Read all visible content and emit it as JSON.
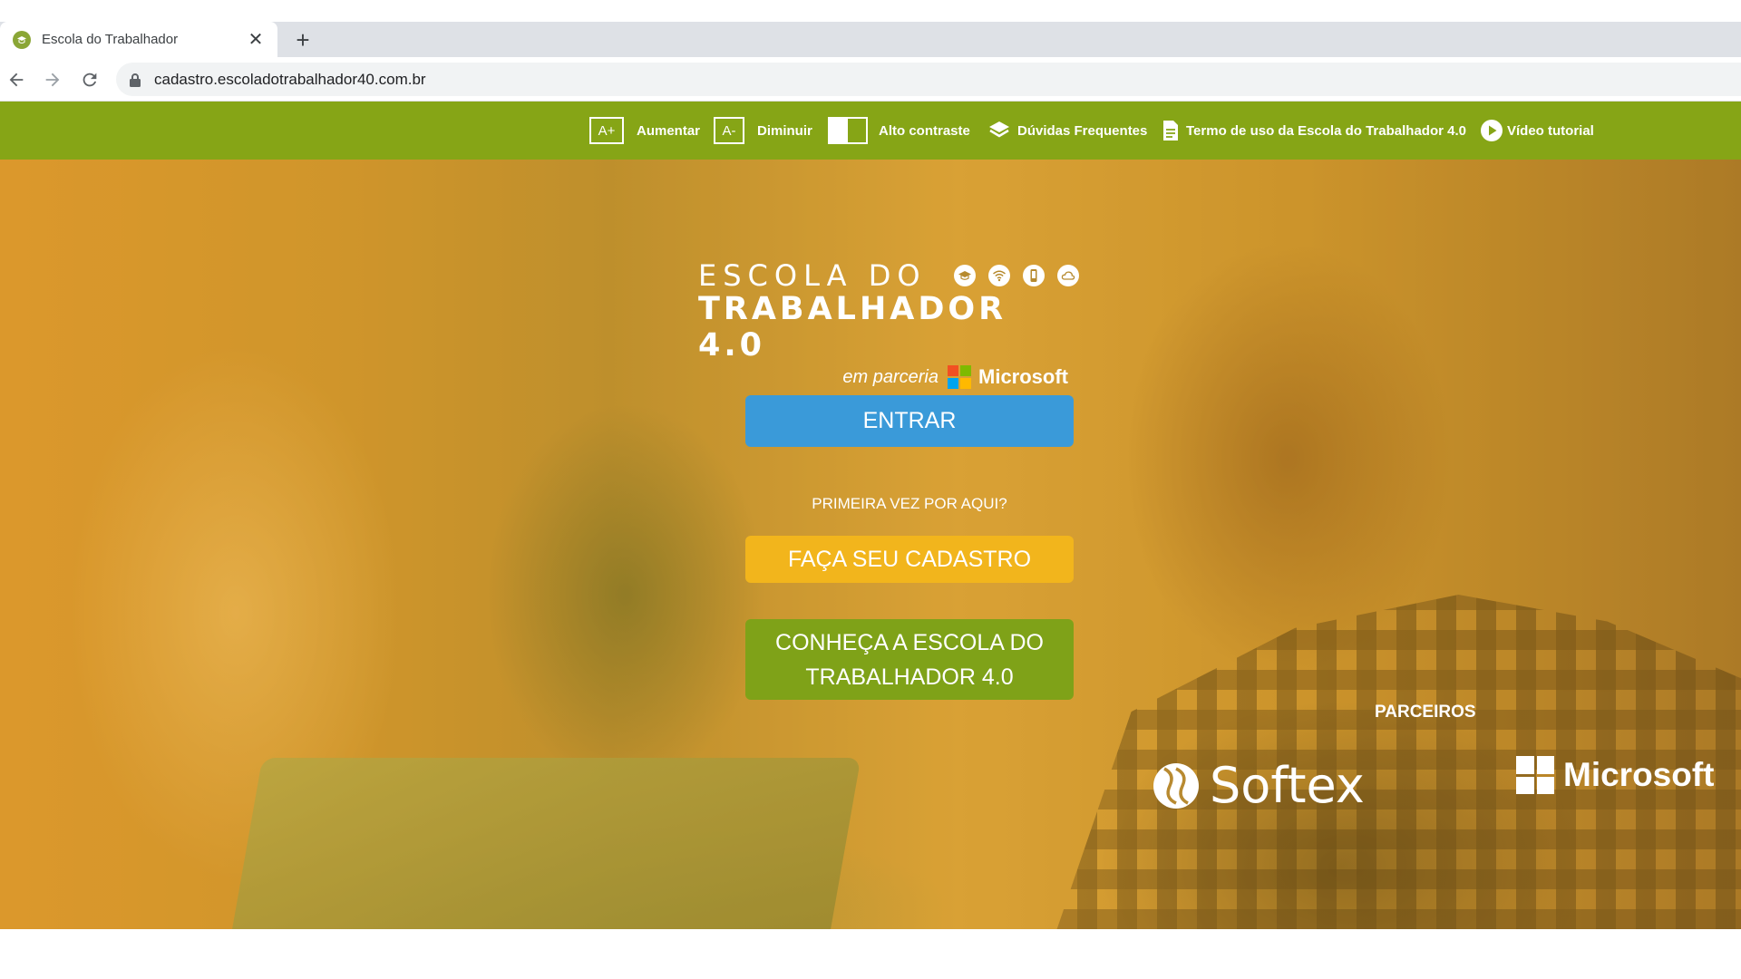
{
  "browser": {
    "tab_title": "Escola do Trabalhador",
    "tab_close": "✕",
    "new_tab": "+",
    "url": "cadastro.escoladotrabalhador40.com.br"
  },
  "accessibility_bar": {
    "increase_box": "A+",
    "increase_label": "Aumentar",
    "decrease_box": "A-",
    "decrease_label": "Diminuir",
    "contrast_label": "Alto contraste",
    "faq_label": "Dúvidas Frequentes",
    "terms_label": "Termo de uso da Escola do Trabalhador 4.0",
    "tutorial_label": "Vídeo tutorial",
    "bar_color": "#86a516"
  },
  "logo": {
    "line1": "ESCOLA DO",
    "line2": "TRABALHADOR 4.0",
    "partner_text": "em parceria",
    "partner_name": "Microsoft",
    "icons": [
      "graduation-cap-icon",
      "wifi-icon",
      "phone-icon",
      "cloud-icon"
    ]
  },
  "actions": {
    "login_label": "ENTRAR",
    "first_time_text": "PRIMEIRA VEZ POR AQUI?",
    "signup_label": "FAÇA SEU CADASTRO",
    "about_line1": "CONHEÇA A ESCOLA DO",
    "about_line2": "TRABALHADOR 4.0",
    "colors": {
      "login": "#3a9ad9",
      "signup": "#f2b51c",
      "about": "#7fa218"
    }
  },
  "partners": {
    "label": "PARCEIROS",
    "softex": "Softex",
    "microsoft": "Microsoft"
  }
}
